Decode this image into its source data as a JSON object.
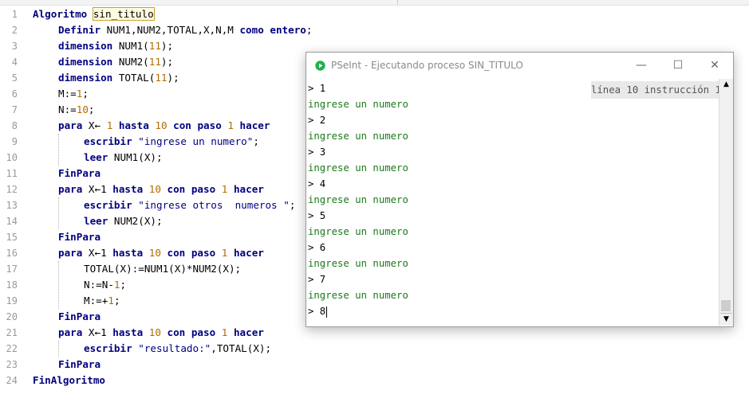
{
  "editor": {
    "line_numbers": [
      "1",
      "2",
      "3",
      "4",
      "5",
      "6",
      "7",
      "8",
      "9",
      "10",
      "11",
      "12",
      "13",
      "14",
      "15",
      "16",
      "17",
      "18",
      "19",
      "20",
      "21",
      "22",
      "23",
      "24"
    ],
    "code": {
      "l1_kw": "Algoritmo",
      "l1_name": "sin_titulo",
      "l2_kw": "Definir",
      "l2_vars": " NUM1,NUM2,TOTAL,X,N,M ",
      "l2_kw2": "como entero",
      "l2_end": ";",
      "l3_kw": "dimension",
      "l3_a": " NUM1(",
      "l3_n": "11",
      "l3_b": ");",
      "l4_kw": "dimension",
      "l4_a": " NUM2(",
      "l4_n": "11",
      "l4_b": ");",
      "l5_kw": "dimension",
      "l5_a": " TOTAL(",
      "l5_n": "11",
      "l5_b": ");",
      "l6_a": "M:=",
      "l6_n": "1",
      "l6_b": ";",
      "l7_a": "N:=",
      "l7_n": "10",
      "l7_b": ";",
      "l8_kw": "para",
      "l8_a": " X← ",
      "l8_n1": "1",
      "l8_kw2": " hasta ",
      "l8_n2": "10",
      "l8_kw3": " con paso ",
      "l8_n3": "1",
      "l8_kw4": " hacer",
      "l9_kw": "escribir",
      "l9_str": " \"ingrese un numero\"",
      "l9_end": ";",
      "l10_kw": "leer",
      "l10_a": " NUM1(X);",
      "l11_kw": "FinPara",
      "l12_kw": "para",
      "l12_a": " X←1",
      "l12_kw2": " hasta ",
      "l12_n2": "10",
      "l12_kw3": " con paso ",
      "l12_n3": "1",
      "l12_kw4": " hacer",
      "l13_kw": "escribir",
      "l13_str": " \"ingrese otros  numeros \"",
      "l13_end": ";",
      "l14_kw": "leer",
      "l14_a": " NUM2(X);",
      "l15_kw": "FinPara",
      "l16_kw": "para",
      "l16_a": " X←1",
      "l16_kw2": " hasta ",
      "l16_n2": "10",
      "l16_kw3": " con paso ",
      "l16_n3": "1",
      "l16_kw4": " hacer",
      "l17_a": "TOTAL(X):=NUM1(X)*NUM2(X);",
      "l18_a": "N:=N-",
      "l18_n": "1",
      "l18_b": ";",
      "l19_a": "M:=+",
      "l19_n": "1",
      "l19_b": ";",
      "l20_kw": "FinPara",
      "l21_kw": "para",
      "l21_a": " X←1",
      "l21_kw2": " hasta ",
      "l21_n2": "10",
      "l21_kw3": " con paso ",
      "l21_n3": "1",
      "l21_kw4": " hacer",
      "l22_kw": "escribir",
      "l22_str": " \"resultado:\"",
      "l22_b": ",TOTAL(X);",
      "l23_kw": "FinPara",
      "l24_kw": "FinAlgoritmo"
    }
  },
  "run_window": {
    "title": "PSeInt - Ejecutando proceso SIN_TITULO",
    "minimize_symbol": "—",
    "maximize_symbol": "☐",
    "close_symbol": "✕",
    "status": "línea 10 instrucción 1",
    "console_lines": [
      "> 1",
      "ingrese un numero",
      "> 2",
      "ingrese un numero",
      "> 3",
      "ingrese un numero",
      "> 4",
      "ingrese un numero",
      "> 5",
      "ingrese un numero",
      "> 6",
      "ingrese un numero",
      "> 7",
      "ingrese un numero",
      "> 8"
    ],
    "scroll_up_symbol": "▲",
    "scroll_down_symbol": "▼"
  },
  "colors": {
    "keyword": "#00007f",
    "number": "#b36b00",
    "output_text": "#1a7a1a",
    "app_icon": "#22b14c"
  },
  "icons": {
    "app": "pseint-play-icon"
  }
}
